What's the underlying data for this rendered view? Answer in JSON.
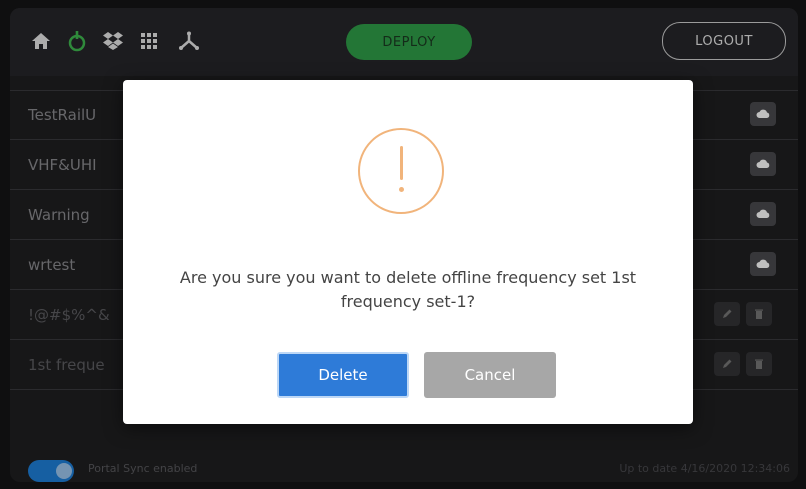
{
  "colors": {
    "deploy_green": "#2f9e48",
    "primary_blue": "#2e7bd8",
    "warning_orange": "#f1b47b",
    "cancel_gray": "#a7a7a7"
  },
  "topbar": {
    "icons": [
      "home-icon",
      "power-icon",
      "dropbox-icon",
      "grid-icon",
      "network-icon"
    ],
    "deploy_label": "DEPLOY",
    "logout_label": "LOGOUT"
  },
  "list": {
    "rows": [
      {
        "label": "TestRailU"
      },
      {
        "label": "VHF&UHI"
      },
      {
        "label": "Warning"
      },
      {
        "label": "wrtest"
      },
      {
        "label": "!@#$%^&"
      },
      {
        "label": "1st freque"
      }
    ]
  },
  "footer": {
    "sync_label": "Portal Sync enabled",
    "status": "Up to date 4/16/2020 12:34:06"
  },
  "modal": {
    "message": "Are you sure you want to delete offline frequency set 1st frequency set-1?",
    "delete_label": "Delete",
    "cancel_label": "Cancel"
  }
}
